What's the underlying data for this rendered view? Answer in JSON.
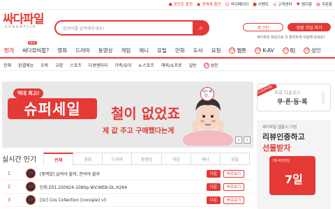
{
  "top_links": [
    {
      "label": "포인트 충전",
      "icon": "coin-icon",
      "red": true
    },
    {
      "label": "정액제 충전",
      "icon": "ticket-icon",
      "red": true
    },
    {
      "label": "마이페이지",
      "icon": "user-icon",
      "red": false
    },
    {
      "label": "이벤트",
      "icon": "gift-icon",
      "red": false
    },
    {
      "label": "고객센터",
      "icon": "headset-icon",
      "red": false
    },
    {
      "label": "찜지함",
      "icon": "heart-icon",
      "red": false
    },
    {
      "label": "쿠폰함",
      "icon": "coupon-icon",
      "red": false
    }
  ],
  "logo": {
    "main": "싸다파일",
    "sub": "SSADAFILE"
  },
  "search": {
    "placeholder": "검색어를 입력해주세요!",
    "icon": "search-icon"
  },
  "auth": {
    "login": "로그인",
    "join": "회원 가입 하기",
    "note": "싸다파일 회원으로 더 편리하게 이용해 보세요!"
  },
  "nav": [
    {
      "label": "인기",
      "active": true
    },
    {
      "label": "싸다뮤비팝?",
      "new": "NEW"
    },
    {
      "label": "영화"
    },
    {
      "label": "드라마"
    },
    {
      "label": "동영상"
    },
    {
      "label": "게임"
    },
    {
      "label": "애니"
    },
    {
      "label": "유틸"
    },
    {
      "label": "만화"
    },
    {
      "label": "도서"
    },
    {
      "label": "요청"
    },
    {
      "label": "웹툰",
      "badge": "19"
    },
    {
      "label": "K-AV",
      "badge": "19"
    },
    {
      "label": "BJ",
      "badge": "19"
    },
    {
      "label": "성인",
      "badge": "19"
    }
  ],
  "subnav": [
    {
      "label": "전체"
    },
    {
      "label": "완결예능"
    },
    {
      "label": "오락"
    },
    {
      "label": "교양"
    },
    {
      "label": "스포츠"
    },
    {
      "label": "다큐멘터리"
    },
    {
      "label": "가족/유아"
    },
    {
      "label": "e-스포츠"
    },
    {
      "label": "해외/쇼프로"
    },
    {
      "label": "일반"
    },
    {
      "label": "성인",
      "badge": "19"
    }
  ],
  "banner": {
    "badge": "역대 최고!",
    "big": "슈퍼세일",
    "headline": "철이 없었죠",
    "subline": "제 값 주고 구매했다는게",
    "bubble": "이? 싸다..",
    "prev": "‹",
    "next": "›"
  },
  "coupon": {
    "tag": "COUPON",
    "line1": "무료 다운로드",
    "line2": "쿠·폰·등·록",
    "side": "SSADA"
  },
  "promo": {
    "line1": "싸다파일 앱출시 기념",
    "line2": "리뷰인증하고",
    "line3": "선물받자",
    "box_label": "7월 싸다파일",
    "box_day": "7일"
  },
  "realtime": {
    "title": "실시간 인기",
    "tabs": [
      "전체",
      "영화",
      "드라마",
      "동영상",
      "게임",
      "애니",
      "유틸"
    ],
    "download_label": "다운",
    "view_label": "바로보기",
    "rows": [
      {
        "rank": "1",
        "thumb": "19",
        "title": "[중백밥] 살려야 할까, 분여야 할까"
      },
      {
        "rank": "2",
        "thumb": "19",
        "title": "단죄.E01.250924.1080p.WV.WEB-DL.H264"
      },
      {
        "rank": "3",
        "thumb": "19",
        "title": "[Gr] Cos Collection [cocopie] v3"
      }
    ]
  },
  "colors": {
    "accent": "#e53935"
  }
}
